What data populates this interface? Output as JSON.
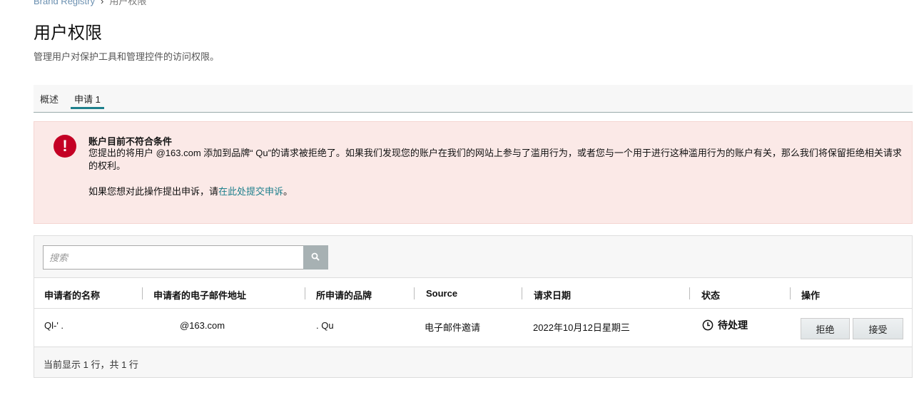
{
  "breadcrumb": {
    "parent": "Brand Registry",
    "separator": "›",
    "current": "用户权限"
  },
  "page": {
    "title": "用户权限",
    "subtitle": "管理用户对保护工具和管理控件的访问权限。"
  },
  "tabs": [
    {
      "label": "概述",
      "active": false
    },
    {
      "label": "申请 1",
      "active": true
    }
  ],
  "alert": {
    "title": "账户目前不符合条件",
    "body": "您提出的将用户        @163.com 添加到品牌“       Qu”的请求被拒绝了。如果我们发现您的账户在我们的网站上参与了滥用行为，或者您与一个用于进行这种滥用行为的账户有关，那么我们将保留拒绝相关请求的权利。",
    "appeal_prefix": "如果您想对此操作提出申诉，请",
    "appeal_link": "在此处提交申诉",
    "appeal_suffix": "。",
    "icon": "exclamation-icon",
    "color": "#c40024"
  },
  "search": {
    "placeholder": "搜索",
    "value": "",
    "icon": "search-icon"
  },
  "table": {
    "headers": [
      "申请者的名称",
      "申请者的电子邮件地址",
      "所申请的品牌",
      "Source",
      "请求日期",
      "状态",
      "操作"
    ],
    "rows": [
      {
        "name": "Ql-'  .",
        "email": "@163.com",
        "brand": ".      Qu",
        "source": "电子邮件邀请",
        "date": "2022年10月12日星期三",
        "status": "待处理",
        "status_icon": "clock-icon",
        "reject_label": "拒绝",
        "accept_label": "接受"
      }
    ]
  },
  "footer": {
    "summary": "当前显示 1 行，共 1 行"
  },
  "colors": {
    "accent": "#1d7f8c",
    "alert_bg": "#fbe9e7",
    "error": "#c40024"
  }
}
